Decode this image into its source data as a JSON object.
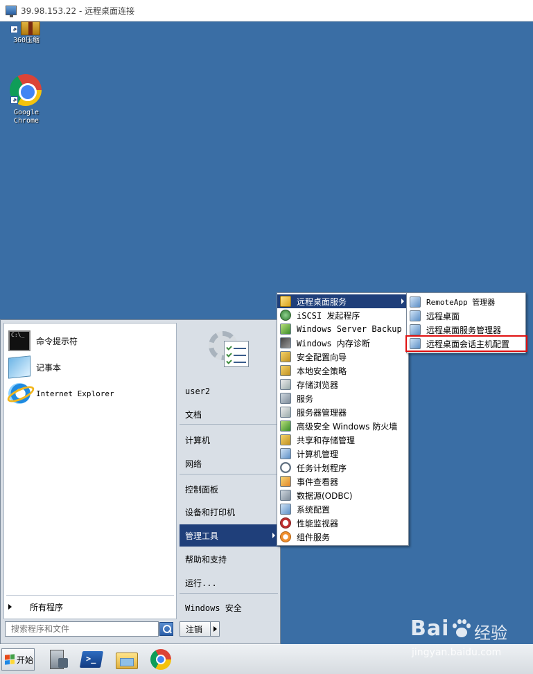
{
  "window": {
    "title": "39.98.153.22 - 远程桌面连接"
  },
  "desktop": {
    "icons": [
      {
        "label": "360压缩"
      },
      {
        "label": "Google Chrome"
      }
    ]
  },
  "start_menu": {
    "pinned": [
      {
        "label": "命令提示符",
        "icon": "cmd-icon"
      },
      {
        "label": "记事本",
        "icon": "notepad-icon"
      },
      {
        "label": "Internet Explorer",
        "icon": "ie-icon"
      }
    ],
    "all_programs": "所有程序",
    "search_placeholder": "搜索程序和文件",
    "right": {
      "user": "user2",
      "documents": "文档",
      "computer": "计算机",
      "network": "网络",
      "control_panel": "控制面板",
      "devices": "设备和打印机",
      "admin_tools": "管理工具",
      "help": "帮助和支持",
      "run": "运行...",
      "security": "Windows 安全"
    },
    "logoff": "注销"
  },
  "admin_tools_menu": {
    "items": [
      "远程桌面服务",
      "iSCSI 发起程序",
      "Windows Server Backup",
      "Windows 内存诊断",
      "安全配置向导",
      "本地安全策略",
      "存储浏览器",
      "服务",
      "服务器管理器",
      "高级安全 Windows 防火墙",
      "共享和存储管理",
      "计算机管理",
      "任务计划程序",
      "事件查看器",
      "数据源(ODBC)",
      "系统配置",
      "性能监视器",
      "组件服务"
    ]
  },
  "rds_menu": {
    "items": [
      "RemoteApp 管理器",
      "远程桌面",
      "远程桌面服务管理器",
      "远程桌面会话主机配置"
    ],
    "highlight_color": "#e01010"
  },
  "taskbar": {
    "start_label": "开始"
  },
  "watermark": {
    "brand": "Bai",
    "cn": "经验",
    "url": "jingyan.baidu.com"
  },
  "colors": {
    "desktop": "#3a6ea5",
    "menu_highlight": "#1f3f7a"
  }
}
